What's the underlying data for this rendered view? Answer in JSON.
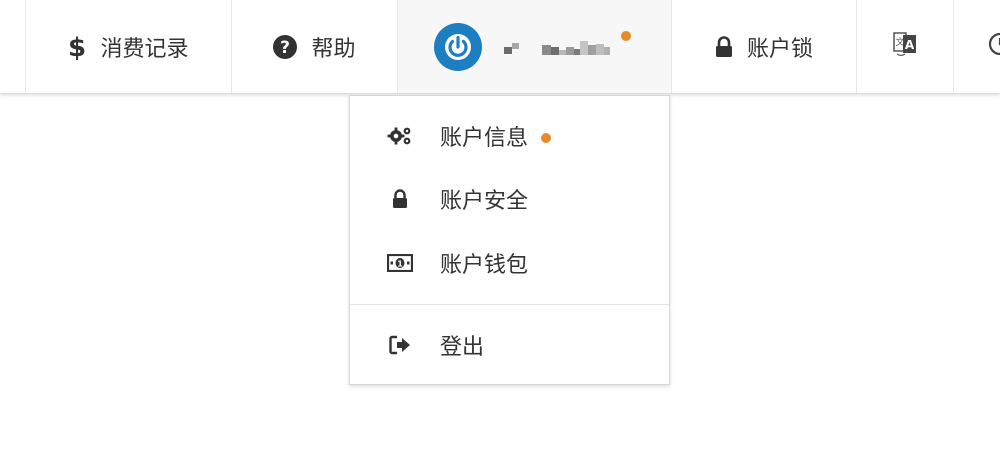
{
  "nav": {
    "billing_label": "消费记录",
    "help_label": "帮助",
    "lock_label": "账户锁",
    "username_masked": "pixelated username",
    "notification_color": "#e8892b",
    "brand_color": "#1d7fc1"
  },
  "account_menu": {
    "items": [
      {
        "label": "账户信息",
        "icon": "gears-icon",
        "has_notification": true
      },
      {
        "label": "账户安全",
        "icon": "lock-icon"
      },
      {
        "label": "账户钱包",
        "icon": "money-bill-icon"
      },
      {
        "label": "登出",
        "icon": "sign-out-icon"
      }
    ]
  }
}
